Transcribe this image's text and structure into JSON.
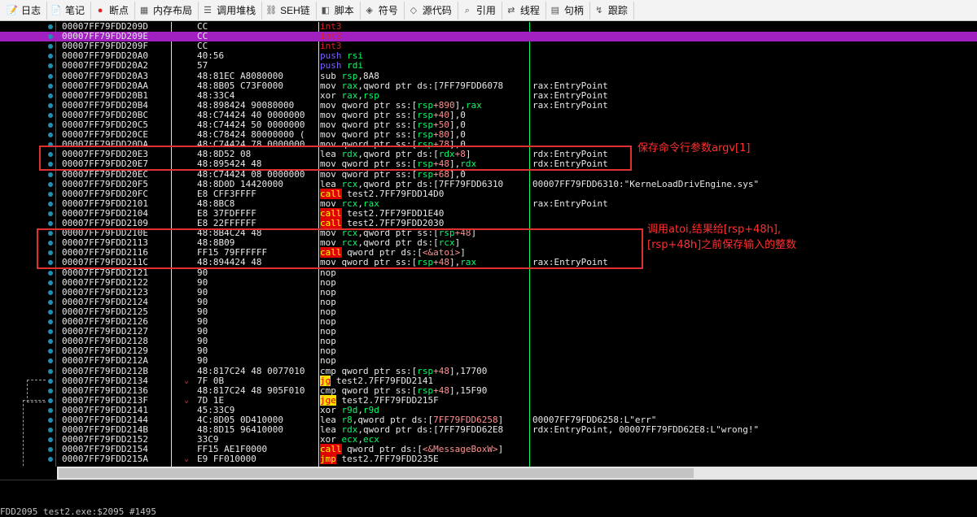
{
  "toolbar": {
    "tabs": [
      {
        "label": "日志",
        "icon": "log-icon"
      },
      {
        "label": "笔记",
        "icon": "notes-icon"
      },
      {
        "label": "断点",
        "icon": "breakpoint-icon"
      },
      {
        "label": "内存布局",
        "icon": "memory-map-icon"
      },
      {
        "label": "调用堆栈",
        "icon": "call-stack-icon"
      },
      {
        "label": "SEH链",
        "icon": "seh-icon"
      },
      {
        "label": "脚本",
        "icon": "script-icon"
      },
      {
        "label": "符号",
        "icon": "symbols-icon"
      },
      {
        "label": "源代码",
        "icon": "source-icon"
      },
      {
        "label": "引用",
        "icon": "references-icon"
      },
      {
        "label": "线程",
        "icon": "threads-icon"
      },
      {
        "label": "句柄",
        "icon": "handles-icon"
      },
      {
        "label": "跟踪",
        "icon": "trace-icon"
      }
    ]
  },
  "rows": [
    {
      "addr": "00007FF79FDD209D",
      "bytes": "CC",
      "instr": "int3",
      "cmt": ""
    },
    {
      "addr": "00007FF79FDD209E",
      "bytes": "CC",
      "instr": "int3",
      "cmt": ""
    },
    {
      "addr": "00007FF79FDD209F",
      "bytes": "CC",
      "instr": "int3",
      "cmt": ""
    },
    {
      "addr": "00007FF79FDD20A0",
      "bytes": "40:56",
      "instr": "push rsi",
      "cmt": ""
    },
    {
      "addr": "00007FF79FDD20A2",
      "bytes": "57",
      "instr": "push rdi",
      "cmt": ""
    },
    {
      "addr": "00007FF79FDD20A3",
      "bytes": "48:81EC A8080000",
      "instr": "sub rsp,8A8",
      "cmt": ""
    },
    {
      "addr": "00007FF79FDD20AA",
      "bytes": "48:8B05 C73F0000",
      "instr": "mov rax,qword ptr ds:[7FF79FDD6078",
      "cmt": "rax:EntryPoint"
    },
    {
      "addr": "00007FF79FDD20B1",
      "bytes": "48:33C4",
      "instr": "xor rax,rsp",
      "cmt": "rax:EntryPoint"
    },
    {
      "addr": "00007FF79FDD20B4",
      "bytes": "48:898424 90080000",
      "instr": "mov qword ptr ss:[rsp+890],rax",
      "cmt": "rax:EntryPoint"
    },
    {
      "addr": "00007FF79FDD20BC",
      "bytes": "48:C74424 40 0000000",
      "instr": "mov qword ptr ss:[rsp+40],0",
      "cmt": ""
    },
    {
      "addr": "00007FF79FDD20C5",
      "bytes": "48:C74424 50 0000000",
      "instr": "mov qword ptr ss:[rsp+50],0",
      "cmt": ""
    },
    {
      "addr": "00007FF79FDD20CE",
      "bytes": "48:C78424 80000000 (",
      "instr": "mov qword ptr ss:[rsp+80],0",
      "cmt": ""
    },
    {
      "addr": "00007FF79FDD20DA",
      "bytes": "48:C74424 78 0000000",
      "instr": "mov qword ptr ss:[rsp+78],0",
      "cmt": ""
    },
    {
      "addr": "00007FF79FDD20E3",
      "bytes": "48:8D52 08",
      "instr": "lea rdx,qword ptr ds:[rdx+8]",
      "cmt": "rdx:EntryPoint"
    },
    {
      "addr": "00007FF79FDD20E7",
      "bytes": "48:895424 48",
      "instr": "mov qword ptr ss:[rsp+48],rdx",
      "cmt": "rdx:EntryPoint"
    },
    {
      "addr": "00007FF79FDD20EC",
      "bytes": "48:C74424 08 0000000",
      "instr": "mov qword ptr ss:[rsp+68],0",
      "cmt": ""
    },
    {
      "addr": "00007FF79FDD20F5",
      "bytes": "48:8D0D 14420000",
      "instr": "lea rcx,qword ptr ds:[7FF79FDD6310",
      "cmt": "00007FF79FDD6310:\"KerneLoadDrivEngine.sys\""
    },
    {
      "addr": "00007FF79FDD20FC",
      "bytes": "E8 CFF3FFFF",
      "instr": "call test2.7FF79FDD14D0",
      "cmt": ""
    },
    {
      "addr": "00007FF79FDD2101",
      "bytes": "48:8BC8",
      "instr": "mov rcx,rax",
      "cmt": "rax:EntryPoint"
    },
    {
      "addr": "00007FF79FDD2104",
      "bytes": "E8 37FDFFFF",
      "instr": "call test2.7FF79FDD1E40",
      "cmt": ""
    },
    {
      "addr": "00007FF79FDD2109",
      "bytes": "E8 22FFFFFF",
      "instr": "call test2.7FF79FDD2030",
      "cmt": ""
    },
    {
      "addr": "00007FF79FDD210E",
      "bytes": "48:8B4C24 48",
      "instr": "mov rcx,qword ptr ss:[rsp+48]",
      "cmt": ""
    },
    {
      "addr": "00007FF79FDD2113",
      "bytes": "48:8B09",
      "instr": "mov rcx,qword ptr ds:[rcx]",
      "cmt": ""
    },
    {
      "addr": "00007FF79FDD2116",
      "bytes": "FF15 79FFFFFF",
      "instr": "call qword ptr ds:[<&atoi>]",
      "cmt": ""
    },
    {
      "addr": "00007FF79FDD211C",
      "bytes": "48:894424 48",
      "instr": "mov qword ptr ss:[rsp+48],rax",
      "cmt": "rax:EntryPoint"
    },
    {
      "addr": "00007FF79FDD2121",
      "bytes": "90",
      "instr": "nop",
      "cmt": ""
    },
    {
      "addr": "00007FF79FDD2122",
      "bytes": "90",
      "instr": "nop",
      "cmt": ""
    },
    {
      "addr": "00007FF79FDD2123",
      "bytes": "90",
      "instr": "nop",
      "cmt": ""
    },
    {
      "addr": "00007FF79FDD2124",
      "bytes": "90",
      "instr": "nop",
      "cmt": ""
    },
    {
      "addr": "00007FF79FDD2125",
      "bytes": "90",
      "instr": "nop",
      "cmt": ""
    },
    {
      "addr": "00007FF79FDD2126",
      "bytes": "90",
      "instr": "nop",
      "cmt": ""
    },
    {
      "addr": "00007FF79FDD2127",
      "bytes": "90",
      "instr": "nop",
      "cmt": ""
    },
    {
      "addr": "00007FF79FDD2128",
      "bytes": "90",
      "instr": "nop",
      "cmt": ""
    },
    {
      "addr": "00007FF79FDD2129",
      "bytes": "90",
      "instr": "nop",
      "cmt": ""
    },
    {
      "addr": "00007FF79FDD212A",
      "bytes": "90",
      "instr": "nop",
      "cmt": ""
    },
    {
      "addr": "00007FF79FDD212B",
      "bytes": "48:817C24 48 0077010",
      "instr": "cmp qword ptr ss:[rsp+48],17700",
      "cmt": ""
    },
    {
      "addr": "00007FF79FDD2134",
      "bytes": "7F 0B",
      "instr": "jg test2.7FF79FDD2141",
      "cmt": "",
      "arrow": true
    },
    {
      "addr": "00007FF79FDD2136",
      "bytes": "48:817C24 48 905F010",
      "instr": "cmp qword ptr ss:[rsp+48],15F90",
      "cmt": ""
    },
    {
      "addr": "00007FF79FDD213F",
      "bytes": "7D 1E",
      "instr": "jge test2.7FF79FDD215F",
      "cmt": "",
      "arrow": true
    },
    {
      "addr": "00007FF79FDD2141",
      "bytes": "45:33C9",
      "instr": "xor r9d,r9d",
      "cmt": ""
    },
    {
      "addr": "00007FF79FDD2144",
      "bytes": "4C:8D05 0D410000",
      "instr": "lea r8,qword ptr ds:[7FF79FDD6258]",
      "cmt": "00007FF79FDD6258:L\"err\""
    },
    {
      "addr": "00007FF79FDD214B",
      "bytes": "48:8D15 96410000",
      "instr": "lea rdx,qword ptr ds:[7FF79FDD62E8",
      "cmt": "rdx:EntryPoint, 00007FF79FDD62E8:L\"wrong!\""
    },
    {
      "addr": "00007FF79FDD2152",
      "bytes": "33C9",
      "instr": "xor ecx,ecx",
      "cmt": ""
    },
    {
      "addr": "00007FF79FDD2154",
      "bytes": "FF15 AE1F0000",
      "instr": "call qword ptr ds:[<&MessageBoxW>]",
      "cmt": ""
    },
    {
      "addr": "00007FF79FDD215A",
      "bytes": "E9 FF010000",
      "instr": "jmp test2.7FF79FDD235E",
      "cmt": "",
      "arrow": true
    }
  ],
  "annotations": {
    "argv": "保存命令行参数argv[1]",
    "atoi_line1": "调用atoi,结果给[rsp+48h],",
    "atoi_line2": "[rsp+48h]之前保存输入的整数"
  },
  "status": {
    "text": "FDD2095 test2.exe:$2095 #1495"
  },
  "colors": {
    "background": "#000000",
    "highlight": "#a020c0",
    "annotation": "#e03030",
    "breakpoint_dot": "#1f8fb3"
  }
}
